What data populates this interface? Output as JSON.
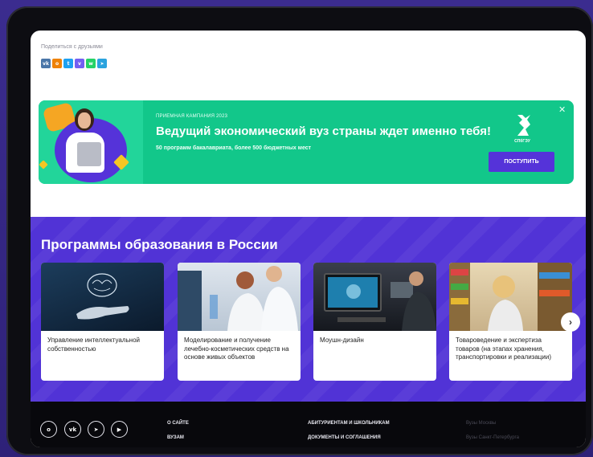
{
  "share": {
    "label": "Поделиться с друзьями",
    "buttons": [
      {
        "name": "vk",
        "glyph": "vk",
        "color": "#4a76a8"
      },
      {
        "name": "ok",
        "glyph": "о",
        "color": "#ee8208"
      },
      {
        "name": "twitter",
        "glyph": "t",
        "color": "#1da1f2"
      },
      {
        "name": "viber",
        "glyph": "v",
        "color": "#7360f2"
      },
      {
        "name": "whatsapp",
        "glyph": "w",
        "color": "#25d366"
      },
      {
        "name": "telegram",
        "glyph": "➤",
        "color": "#2aa3de"
      }
    ]
  },
  "banner": {
    "tag": "ПРИЕМНАЯ КАМПАНИЯ 2023",
    "headline": "Ведущий экономический вуз страны ждет именно тебя!",
    "subline": "50 программ бакалавриата, более 500 бюджетных мест",
    "button": "ПОСТУПИТЬ",
    "logo_caption": "СПбГЭУ",
    "close": "✕"
  },
  "programs": {
    "title": "Программы образования в России",
    "cards": [
      {
        "label": "Управление интеллектуальной собственностью",
        "image": "brain-hand"
      },
      {
        "label": "Моделирование и получение лечебно-косметических средств на основе живых объектов",
        "image": "lab-scientists"
      },
      {
        "label": "Моушн-дизайн",
        "image": "designer-monitor"
      },
      {
        "label": "Товароведение и экспертиза товаров (на этапах хранения, транспортировки и реализации)",
        "image": "store-shelves"
      }
    ],
    "next_arrow": "›"
  },
  "footer": {
    "socials": [
      {
        "name": "ok",
        "glyph": "о"
      },
      {
        "name": "vk",
        "glyph": "vk"
      },
      {
        "name": "telegram",
        "glyph": "➤"
      },
      {
        "name": "youtube",
        "glyph": "▶"
      }
    ],
    "links_col1": [
      "О САЙТЕ",
      "ВУЗАМ"
    ],
    "links_col2": [
      "АБИТУРИЕНТАМ И ШКОЛЬНИКАМ",
      "ДОКУМЕНТЫ И СОГЛАШЕНИЯ"
    ],
    "links_col3": [
      "Вузы Москвы",
      "Вузы Санкт-Петербурга"
    ]
  },
  "colors": {
    "background": "#3b2c8f",
    "banner_green": "#12c78a",
    "accent_purple": "#5533d9",
    "programs_bg": "#5133d6",
    "footer_bg": "#08080c"
  }
}
